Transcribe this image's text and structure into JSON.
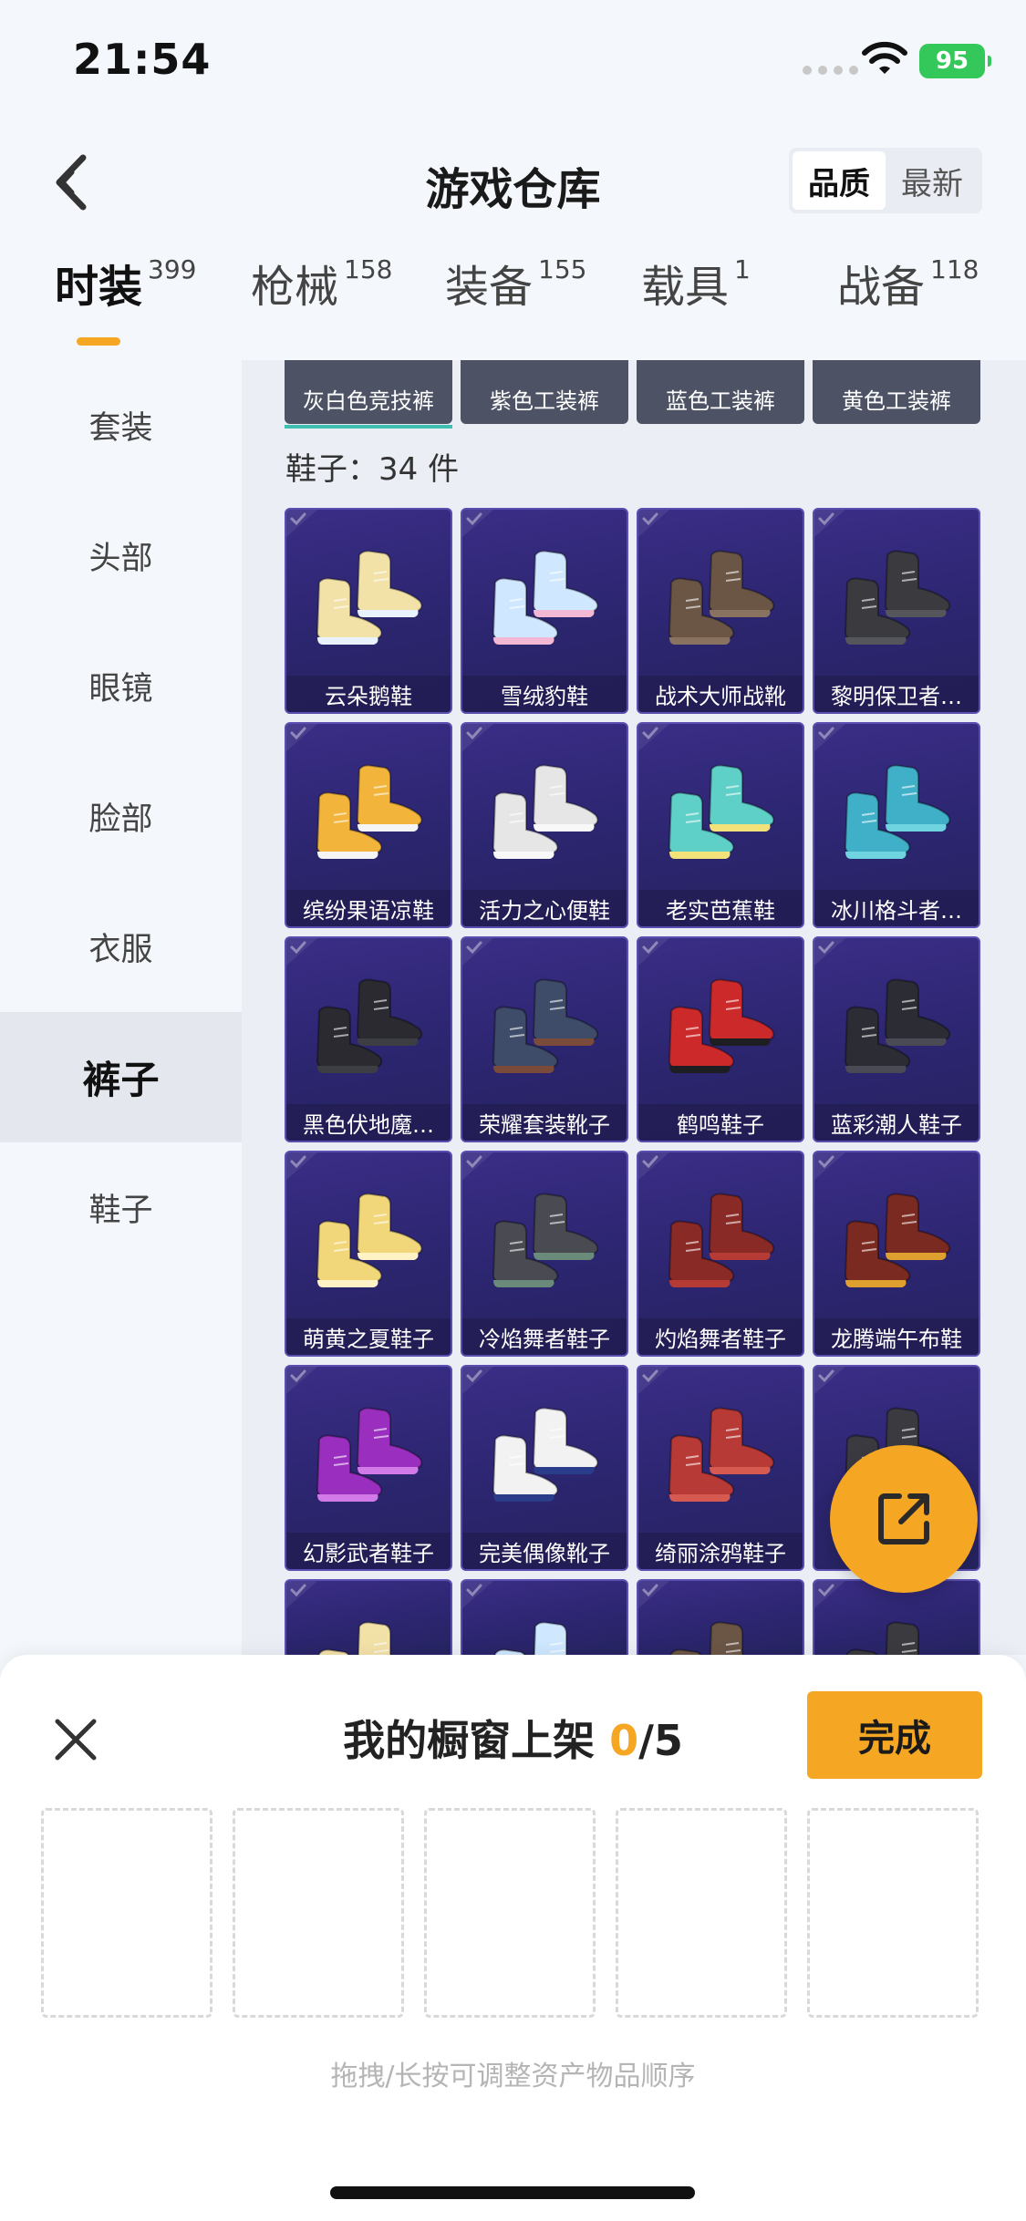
{
  "status_bar": {
    "time": "21:54",
    "battery": "95"
  },
  "header": {
    "title": "游戏仓库",
    "sort_options": [
      {
        "label": "品质",
        "active": true
      },
      {
        "label": "最新",
        "active": false
      }
    ]
  },
  "categories": [
    {
      "label": "时装",
      "count": "399",
      "active": true
    },
    {
      "label": "枪械",
      "count": "158",
      "active": false
    },
    {
      "label": "装备",
      "count": "155",
      "active": false
    },
    {
      "label": "载具",
      "count": "1",
      "active": false
    },
    {
      "label": "战备",
      "count": "118",
      "active": false
    }
  ],
  "sidebar": {
    "items": [
      {
        "label": "套装",
        "active": false
      },
      {
        "label": "头部",
        "active": false
      },
      {
        "label": "眼镜",
        "active": false
      },
      {
        "label": "脸部",
        "active": false
      },
      {
        "label": "衣服",
        "active": false
      },
      {
        "label": "裤子",
        "active": true
      },
      {
        "label": "鞋子",
        "active": false
      }
    ]
  },
  "content": {
    "pants_row": [
      "灰白色竞技裤",
      "紫色工装裤",
      "蓝色工装裤",
      "黄色工装裤"
    ],
    "shoes_section_label": "鞋子：34 件",
    "shoes": [
      "云朵鹅鞋",
      "雪绒豹鞋",
      "战术大师战靴",
      "黎明保卫者…",
      "缤纷果语凉鞋",
      "活力之心便鞋",
      "老实芭蕉鞋",
      "冰川格斗者…",
      "黑色伏地魔…",
      "荣耀套装靴子",
      "鹤鸣鞋子",
      "蓝彩潮人鞋子",
      "萌黄之夏鞋子",
      "冷焰舞者鞋子",
      "灼焰舞者鞋子",
      "龙腾端午布鞋",
      "幻影武者鞋子",
      "完美偶像靴子",
      "绮丽涂鸦鞋子",
      ""
    ]
  },
  "sheet": {
    "title_prefix": "我的橱窗上架 ",
    "count_current": "0",
    "count_total": "/5",
    "done_label": "完成",
    "hint": "拖拽/长按可调整资产物品顺序"
  },
  "colors": {
    "accent": "#f5a623",
    "card_bg": "#2b256e",
    "battery": "#34c759"
  },
  "icons": [
    "back-icon",
    "wifi-icon",
    "check-icon",
    "shoe-icon",
    "share-icon",
    "close-icon"
  ]
}
